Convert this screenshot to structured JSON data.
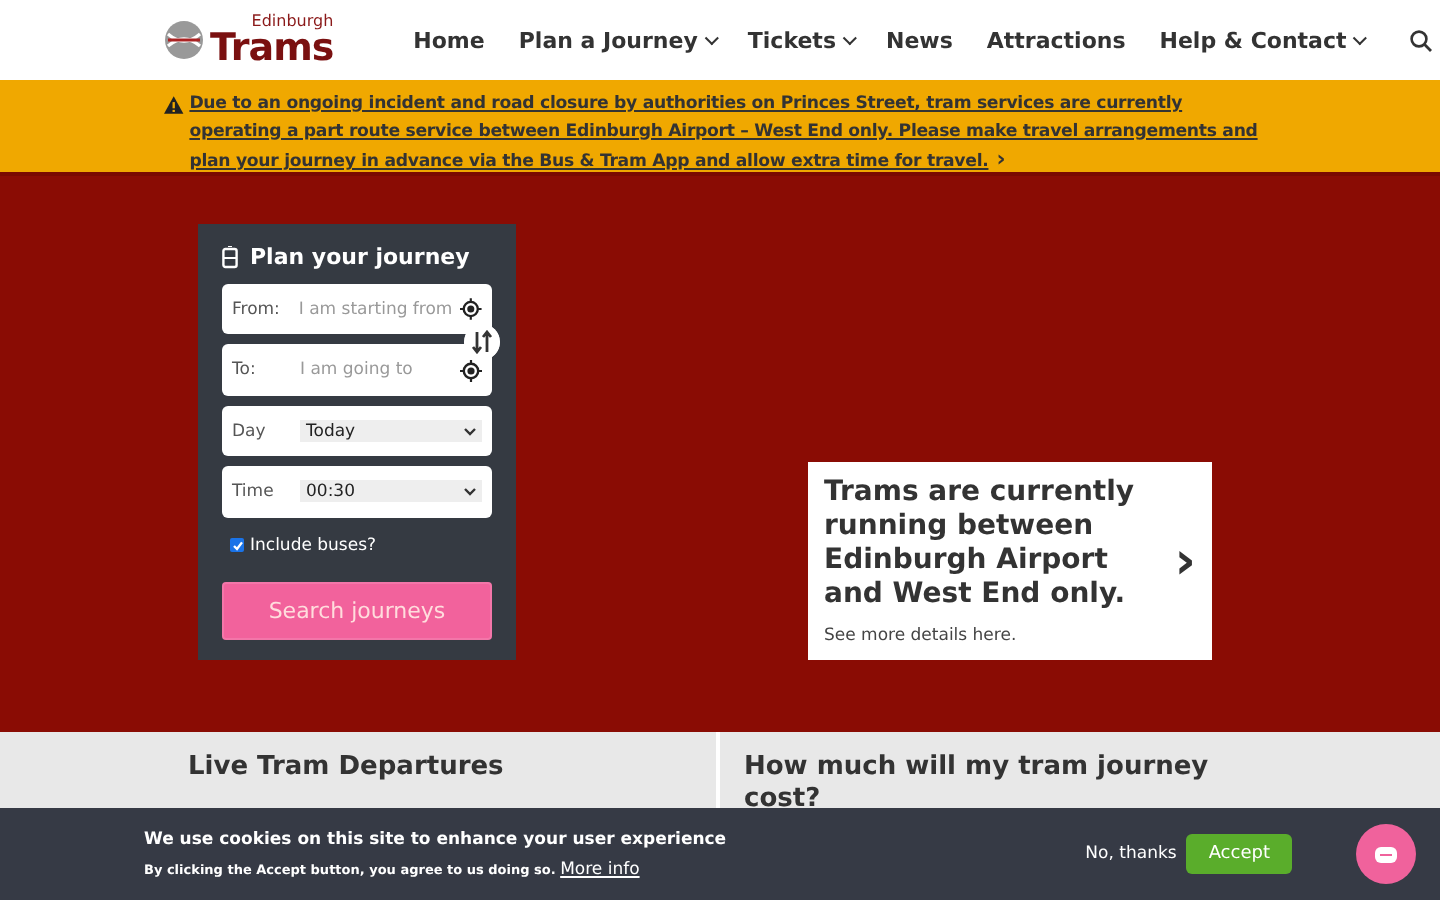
{
  "header": {
    "logo": {
      "small": "Edinburgh",
      "big": "Trams"
    },
    "nav": [
      {
        "label": "Home",
        "dropdown": false
      },
      {
        "label": "Plan a Journey",
        "dropdown": true
      },
      {
        "label": "Tickets",
        "dropdown": true
      },
      {
        "label": "News",
        "dropdown": false
      },
      {
        "label": "Attractions",
        "dropdown": false
      },
      {
        "label": "Help & Contact",
        "dropdown": true
      }
    ]
  },
  "alert": {
    "text": "Due to an ongoing incident and road closure by authorities on Princes Street, tram services are currently operating a part route service between Edinburgh Airport – West End only. Please make travel arrangements and plan your journey in advance via the Bus & Tram App and allow extra time for travel.",
    "chevron": "›"
  },
  "planner": {
    "title": "Plan your journey",
    "fields": [
      {
        "kind": "location",
        "label": "From:",
        "placeholder": "I am starting from"
      },
      {
        "kind": "location",
        "label": "To:",
        "placeholder": "I am going to"
      },
      {
        "kind": "select",
        "label": "Day",
        "value": "Today"
      },
      {
        "kind": "select",
        "label": "Time",
        "value": "00:30"
      }
    ],
    "include_buses": {
      "label": "Include buses?",
      "checked": true
    },
    "button": "Search journeys"
  },
  "notice": {
    "heading": "Trams are currently running between Edinburgh Airport and West End only.",
    "link": "See more details here.",
    "chevron": "›"
  },
  "sections": [
    {
      "heading": "Live Tram Departures"
    },
    {
      "heading": "How much will my tram journey cost?"
    }
  ],
  "cookie": {
    "title": "We use cookies on this site to enhance your user experience",
    "text": "By clicking the Accept button, you agree to us doing so.",
    "link": "More info",
    "decline": "No, thanks",
    "accept": "Accept"
  }
}
